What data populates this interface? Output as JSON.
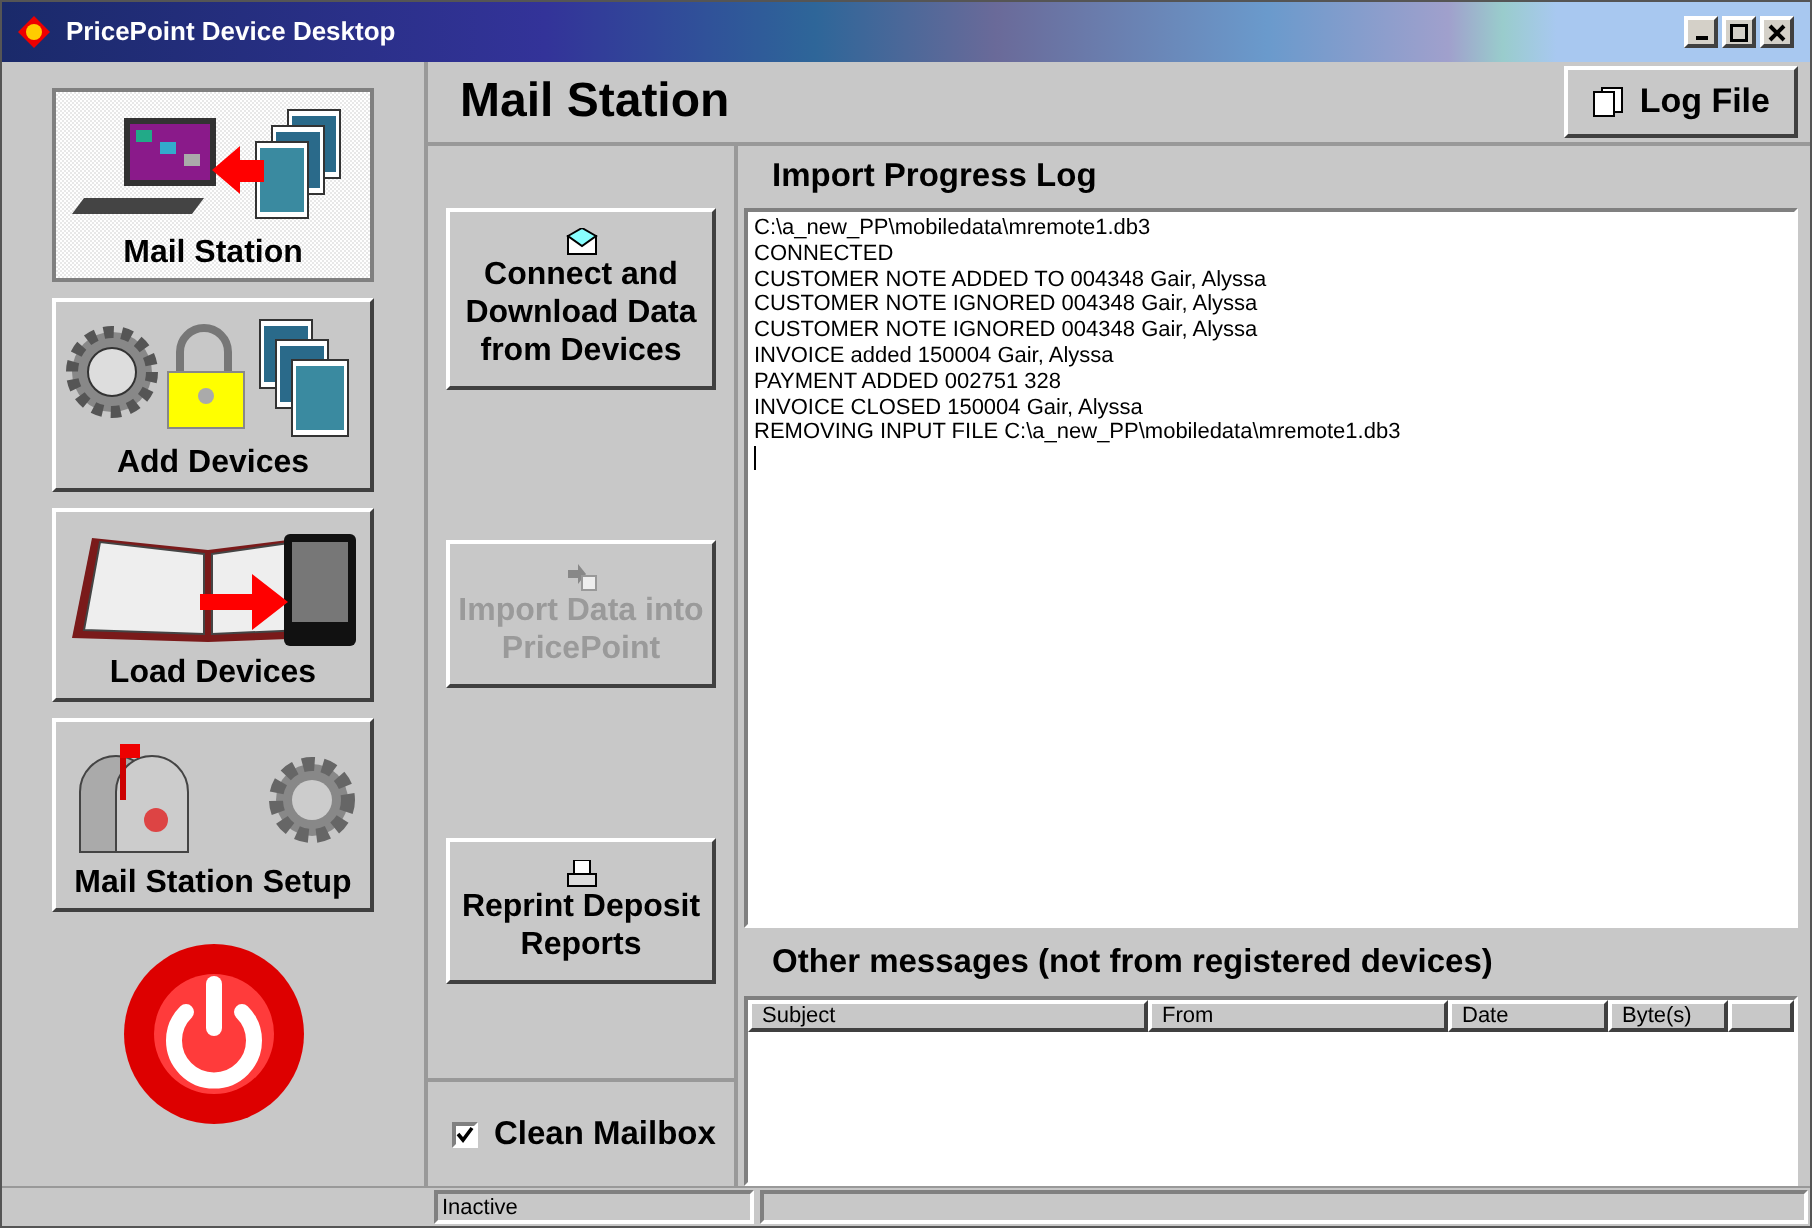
{
  "window": {
    "title": "PricePoint Device Desktop"
  },
  "nav": [
    {
      "label": "Mail Station",
      "selected": true
    },
    {
      "label": "Add Devices",
      "selected": false
    },
    {
      "label": "Load Devices",
      "selected": false
    },
    {
      "label": "Mail Station Setup",
      "selected": false
    }
  ],
  "header": {
    "title": "Mail Station",
    "log_button": "Log File"
  },
  "actions": [
    {
      "label": "Connect and Download Data from Devices",
      "disabled": false
    },
    {
      "label": "Import Data into PricePoint",
      "disabled": true
    },
    {
      "label": "Reprint Deposit Reports",
      "disabled": false
    }
  ],
  "clean_mailbox": {
    "label": "Clean Mailbox",
    "checked": true
  },
  "log": {
    "title": "Import Progress Log",
    "lines": [
      "C:\\a_new_PP\\mobiledata\\mremote1.db3",
      "CONNECTED",
      "CUSTOMER NOTE ADDED TO 004348 Gair, Alyssa",
      "CUSTOMER NOTE IGNORED 004348 Gair, Alyssa",
      "CUSTOMER NOTE IGNORED 004348 Gair, Alyssa",
      "INVOICE added 150004 Gair, Alyssa",
      "PAYMENT ADDED 002751 328",
      "INVOICE CLOSED 150004 Gair, Alyssa",
      "REMOVING INPUT FILE C:\\a_new_PP\\mobiledata\\mremote1.db3"
    ]
  },
  "messages": {
    "title": "Other messages (not from registered devices)",
    "columns": [
      "Subject",
      "From",
      "Date",
      "Byte(s)"
    ]
  },
  "status_bar": {
    "text": "Inactive"
  }
}
